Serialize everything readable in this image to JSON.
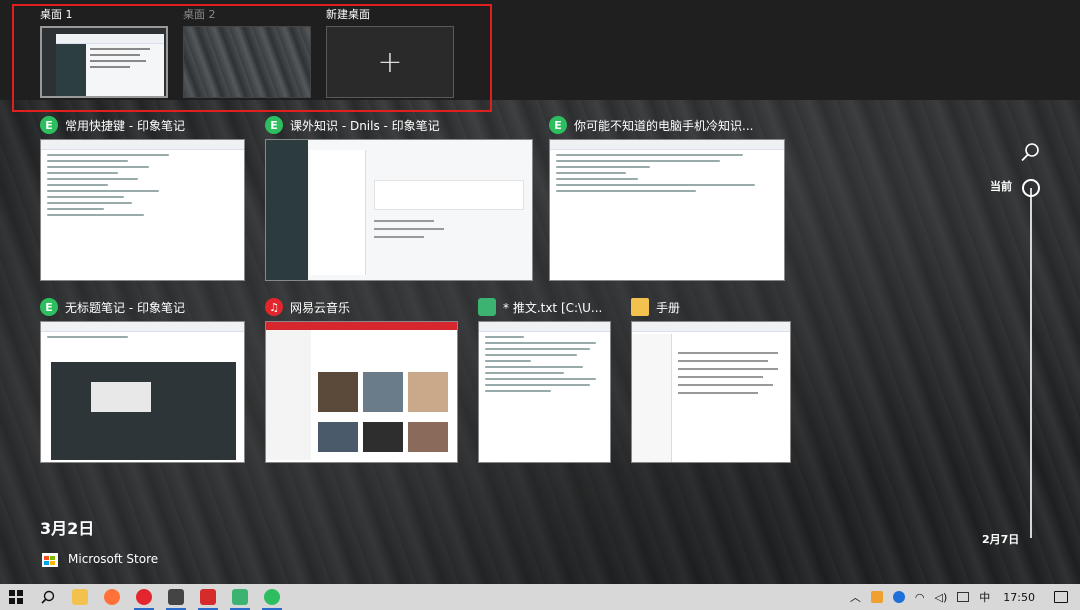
{
  "desktops": [
    {
      "label": "桌面 1",
      "active": true
    },
    {
      "label": "桌面 2",
      "active": false
    },
    {
      "label": "新建桌面",
      "plus": "+"
    }
  ],
  "windows": [
    {
      "title": "常用快捷键 - 印象笔记",
      "icon": "evernote-icon",
      "accent": "#2dbe60"
    },
    {
      "title": "课外知识 - Dnils - 印象笔记",
      "icon": "evernote-icon",
      "accent": "#2dbe60"
    },
    {
      "title": "你可能不知道的电脑手机冷知识...",
      "icon": "evernote-icon",
      "accent": "#2dbe60"
    },
    {
      "title": "无标题笔记 - 印象笔记",
      "icon": "evernote-icon",
      "accent": "#2dbe60"
    },
    {
      "title": "网易云音乐",
      "icon": "netease-music-icon",
      "accent": "#e3262e"
    },
    {
      "title": "* 推文.txt [C:\\U...",
      "icon": "notepad-icon",
      "accent": "#3cb371"
    },
    {
      "title": "手册",
      "icon": "folder-icon",
      "accent": "#f2c14e"
    }
  ],
  "timeline": {
    "current": "当前",
    "date_bottom": "2月7日"
  },
  "day_header": "3月2日",
  "activity": {
    "label": "Microsoft Store"
  },
  "tray": {
    "time": "17:50"
  }
}
